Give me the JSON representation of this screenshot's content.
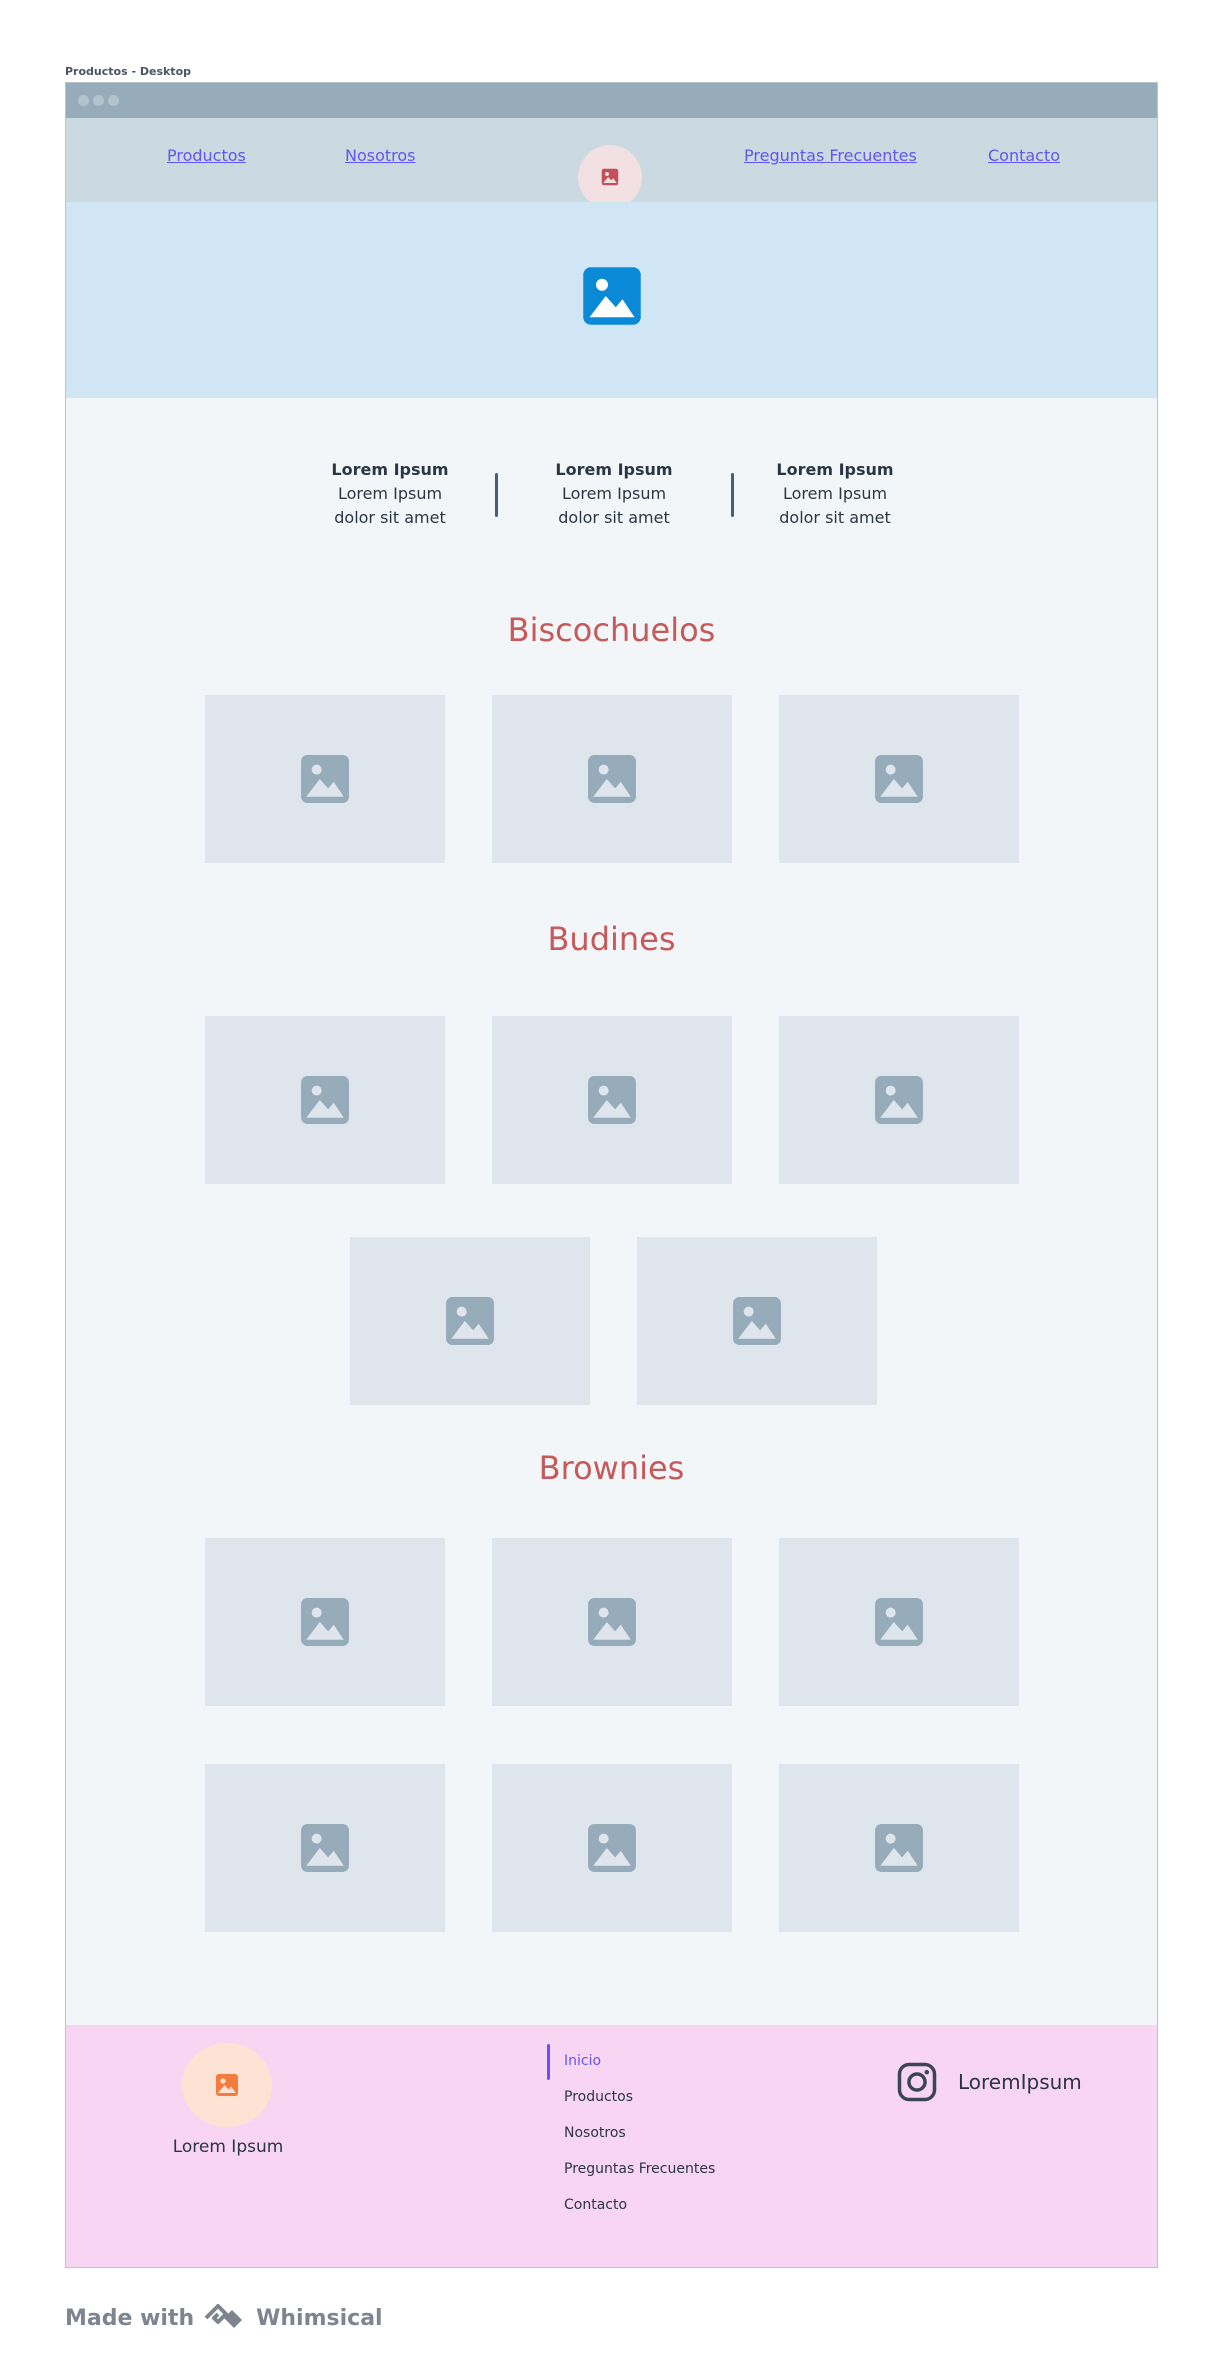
{
  "frame": {
    "label": "Productos - Desktop"
  },
  "nav": {
    "links": [
      "Productos",
      "Nosotros",
      "Preguntas Frecuentes",
      "Contacto"
    ],
    "logo_icon": "image-icon"
  },
  "hero": {
    "icon": "image-icon",
    "color": "#0a8ad6"
  },
  "stats": [
    {
      "title": "Lorem Ipsum",
      "line1": "Lorem Ipsum",
      "line2": "dolor sit amet"
    },
    {
      "title": "Lorem Ipsum",
      "line1": "Lorem Ipsum",
      "line2": "dolor sit amet"
    },
    {
      "title": "Lorem Ipsum",
      "line1": "Lorem Ipsum",
      "line2": "dolor sit amet"
    }
  ],
  "sections": [
    {
      "title": "Biscochuelos",
      "image_count": 3
    },
    {
      "title": "Budines",
      "image_count": 5
    },
    {
      "title": "Brownies",
      "image_count": 6
    }
  ],
  "footer": {
    "brand": "Lorem Ipsum",
    "links": [
      "Inicio",
      "Productos",
      "Nosotros",
      "Preguntas Frecuentes",
      "Contacto"
    ],
    "active_link": "Inicio",
    "social_icon": "instagram-icon",
    "social_label": "LoremIpsum"
  },
  "badge": {
    "prefix": "Made with",
    "brand": "Whimsical"
  },
  "colors": {
    "accent": "#6355ee",
    "section_title": "#c65a5a",
    "hero_bg": "#d1e6f5",
    "footer_bg": "#f9d5f4"
  }
}
